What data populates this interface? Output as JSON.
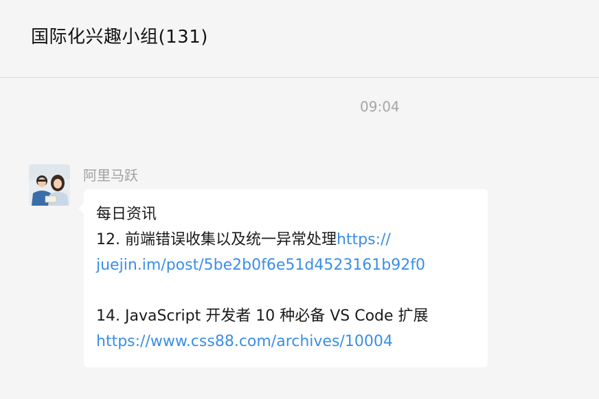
{
  "header": {
    "title": "国际化兴趣小组(131)"
  },
  "timestamp": "09:04",
  "message": {
    "sender": "阿里马跃",
    "heading": "每日资讯",
    "item1_text": "12. 前端错误收集以及统一异常处理",
    "item1_link_part1": "https://",
    "item1_link_part2": "juejin.im/post/5be2b0f6e51d4523161b92f0",
    "item2_text": "14. JavaScript 开发者 10 种必备 VS Code 扩展",
    "item2_link": "https://www.css88.com/archives/10004"
  },
  "colors": {
    "link": "#3a8ee6",
    "bubble": "#ffffff",
    "background": "#f5f5f5",
    "meta_text": "#a6a6a6"
  }
}
